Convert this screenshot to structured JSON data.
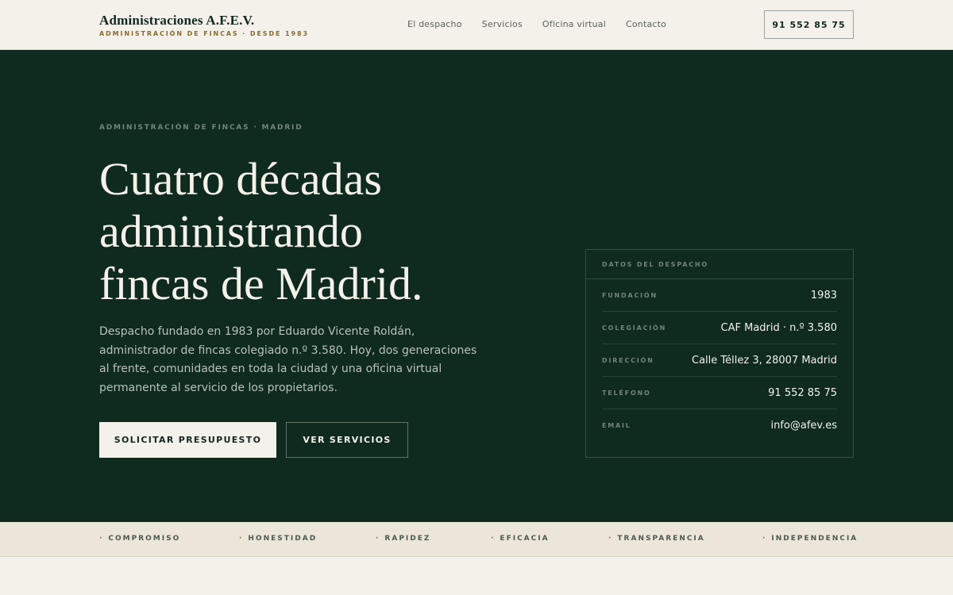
{
  "header": {
    "brand_name": "Administraciones A.F.E.V.",
    "brand_tagline": "ADMINISTRACIÓN DE FINCAS · DESDE 1983",
    "nav": [
      {
        "label": "El despacho"
      },
      {
        "label": "Servicios"
      },
      {
        "label": "Oficina virtual"
      },
      {
        "label": "Contacto"
      }
    ],
    "phone_button": "91 552 85 75"
  },
  "hero": {
    "eyebrow": "ADMINISTRACIÓN DE FINCAS · MADRID",
    "headline_lines": [
      "Cuatro décadas",
      "administrando",
      "fincas de Madrid."
    ],
    "lede": "Despacho fundado en 1983 por Eduardo Vicente Roldán, administrador de fincas colegiado n.º 3.580. Hoy, dos generaciones al frente, comunidades en toda la ciudad y una oficina virtual permanente al servicio de los propietarios.",
    "primary_cta": "SOLICITAR PRESUPUESTO",
    "secondary_cta": "VER SERVICIOS"
  },
  "card": {
    "title": "DATOS DEL DESPACHO",
    "rows": [
      {
        "key": "FUNDACIÓN",
        "value": "1983"
      },
      {
        "key": "COLEGIACIÓN",
        "value": "CAF Madrid · n.º 3.580"
      },
      {
        "key": "DIRECCIÓN",
        "value": "Calle Téllez 3, 28007 Madrid"
      },
      {
        "key": "TELÉFONO",
        "value": "91 552 85 75"
      },
      {
        "key": "EMAIL",
        "value": "info@afev.es"
      }
    ]
  },
  "values": [
    {
      "label": "COMPROMISO"
    },
    {
      "label": "HONESTIDAD"
    },
    {
      "label": "RAPIDEZ"
    },
    {
      "label": "EFICACIA"
    },
    {
      "label": "TRANSPARENCIA"
    },
    {
      "label": "INDEPENDENCIA"
    }
  ],
  "colors": {
    "hero_bg": "#0f2a1f",
    "page_bg": "#f4f1ea",
    "accent_gold": "#8a6a2e"
  }
}
